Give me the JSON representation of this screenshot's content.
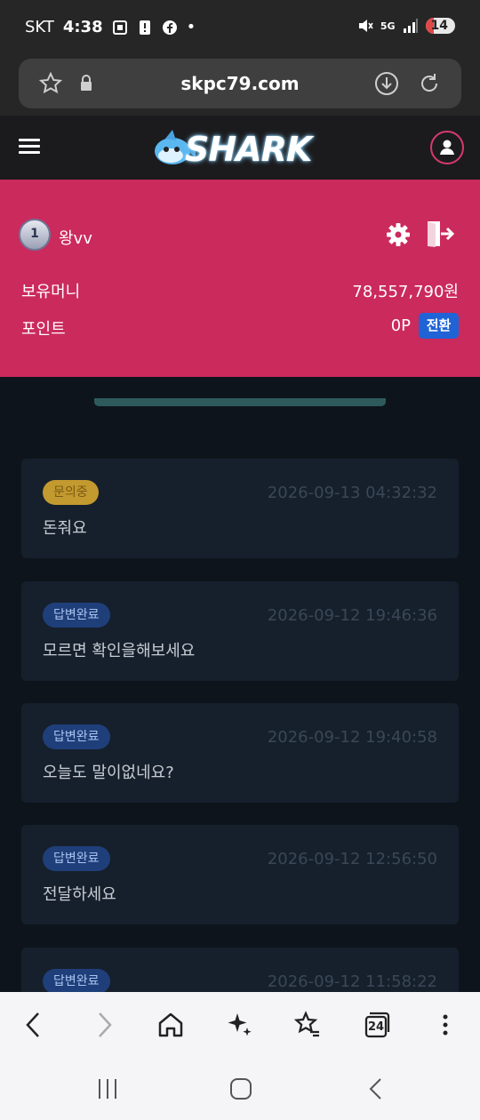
{
  "status_bar": {
    "carrier": "SKT",
    "time": "4:38",
    "network": "5G",
    "battery": "14",
    "dot": "•"
  },
  "browser": {
    "url": "skpc79.com"
  },
  "header": {
    "logo_text": "SHARK"
  },
  "account": {
    "rank": "1",
    "username": "왕vv",
    "money_label": "보유머니",
    "money_value": "78,557,790원",
    "point_label": "포인트",
    "point_value": "0P",
    "convert_label": "전환"
  },
  "inquiries": [
    {
      "status": "문의중",
      "status_type": "pending",
      "date": "2026-09-13 04:32:32",
      "title": "돈줘요"
    },
    {
      "status": "답변완료",
      "status_type": "done",
      "date": "2026-09-12 19:46:36",
      "title": "모르면 확인을해보세요"
    },
    {
      "status": "답변완료",
      "status_type": "done",
      "date": "2026-09-12 19:40:58",
      "title": "오늘도 말이없네요?"
    },
    {
      "status": "답변완료",
      "status_type": "done",
      "date": "2026-09-12 12:56:50",
      "title": "전달하세요"
    },
    {
      "status": "답변완료",
      "status_type": "done",
      "date": "2026-09-12 11:58:22",
      "title": ""
    }
  ],
  "bottom_nav": {
    "tabs_count": "24"
  },
  "colors": {
    "accent": "#cb2a5c",
    "convert_button": "#1f63d6",
    "pending_badge": "#c39a2f",
    "done_badge": "#1f3f7a"
  }
}
